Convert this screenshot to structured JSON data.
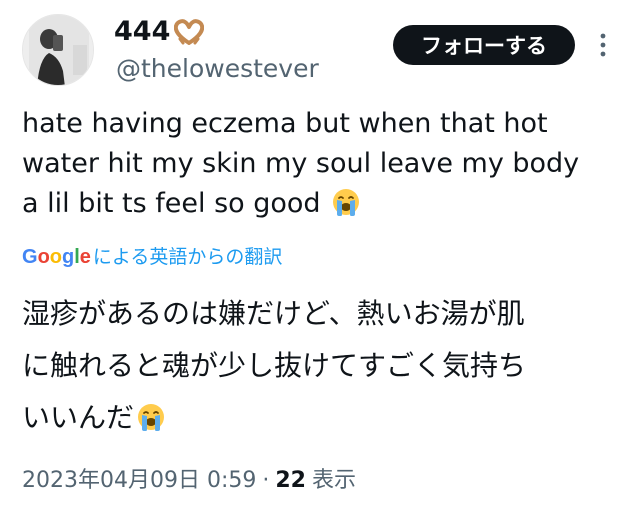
{
  "user": {
    "display_name": "444",
    "display_name_emoji": "heart-hands-icon",
    "handle": "@thelowestever"
  },
  "actions": {
    "follow_label": "フォローする",
    "more_icon": "more-vertical-icon"
  },
  "tweet": {
    "lines": [
      "hate having eczema but when that hot",
      "water hit my skin my soul leave my body",
      "a lil bit ts feel so good"
    ],
    "trailing_emoji": "loudly-crying-face-icon"
  },
  "translation": {
    "provider_logo_text": "Google",
    "label": "による英語からの翻訳",
    "lines": [
      "湿疹があるのは嫌だけど、熱いお湯が肌",
      "に触れると魂が少し抜けてすごく気持ち",
      "いいんだ"
    ],
    "trailing_emoji": "loudly-crying-face-icon"
  },
  "meta": {
    "timestamp": "2023年04月09日 0:59",
    "separator": "·",
    "views_count": "22",
    "views_label": "表示"
  },
  "colors": {
    "follow_bg": "#0f1419",
    "link_blue": "#1d9bf0",
    "secondary_text": "#536471"
  }
}
